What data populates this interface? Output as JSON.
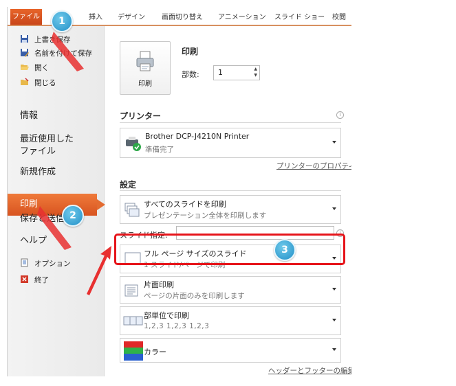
{
  "ribbon": {
    "file_tab": "ファイル",
    "tabs": [
      "挿入",
      "デザイン",
      "画面切り替え",
      "アニメーション",
      "スライド ショー",
      "校閲"
    ]
  },
  "menu": {
    "save": "上書き保存",
    "save_as": "名前を付けて保存",
    "open": "開く",
    "close": "閉じる",
    "info": "情報",
    "recent_1": "最近使用した",
    "recent_2": "ファイル",
    "new": "新規作成",
    "print": "印刷",
    "save_send": "保存と送信",
    "help": "ヘルプ",
    "options": "オプション",
    "exit": "終了"
  },
  "print": {
    "title": "印刷",
    "button_label": "印刷",
    "copies_label": "部数:",
    "copies_value": "1"
  },
  "printer": {
    "section": "プリンター",
    "name": "Brother DCP-J4210N Printer",
    "status": "準備完了",
    "properties_link": "プリンターのプロパティ"
  },
  "settings": {
    "section": "設定",
    "slides": {
      "title": "すべてのスライドを印刷",
      "sub": "プレゼンテーション全体を印刷します"
    },
    "slide_spec_label": "スライド指定:",
    "slide_spec_value": "",
    "layout": {
      "title": "フル ページ サイズのスライド",
      "sub": "1 スライド/ページで印刷"
    },
    "sides": {
      "title": "片面印刷",
      "sub": "ページの片面のみを印刷します"
    },
    "collate": {
      "title": "部単位で印刷",
      "sub": "1,2,3   1,2,3   1,2,3"
    },
    "color": {
      "title": "カラー"
    },
    "header_footer_link": "ヘッダーとフッターの編集"
  },
  "annotations": {
    "step1": "1",
    "step2": "2",
    "step3": "3",
    "highlight_color": "#e6141a",
    "badge_color": "#2a9bd0"
  }
}
